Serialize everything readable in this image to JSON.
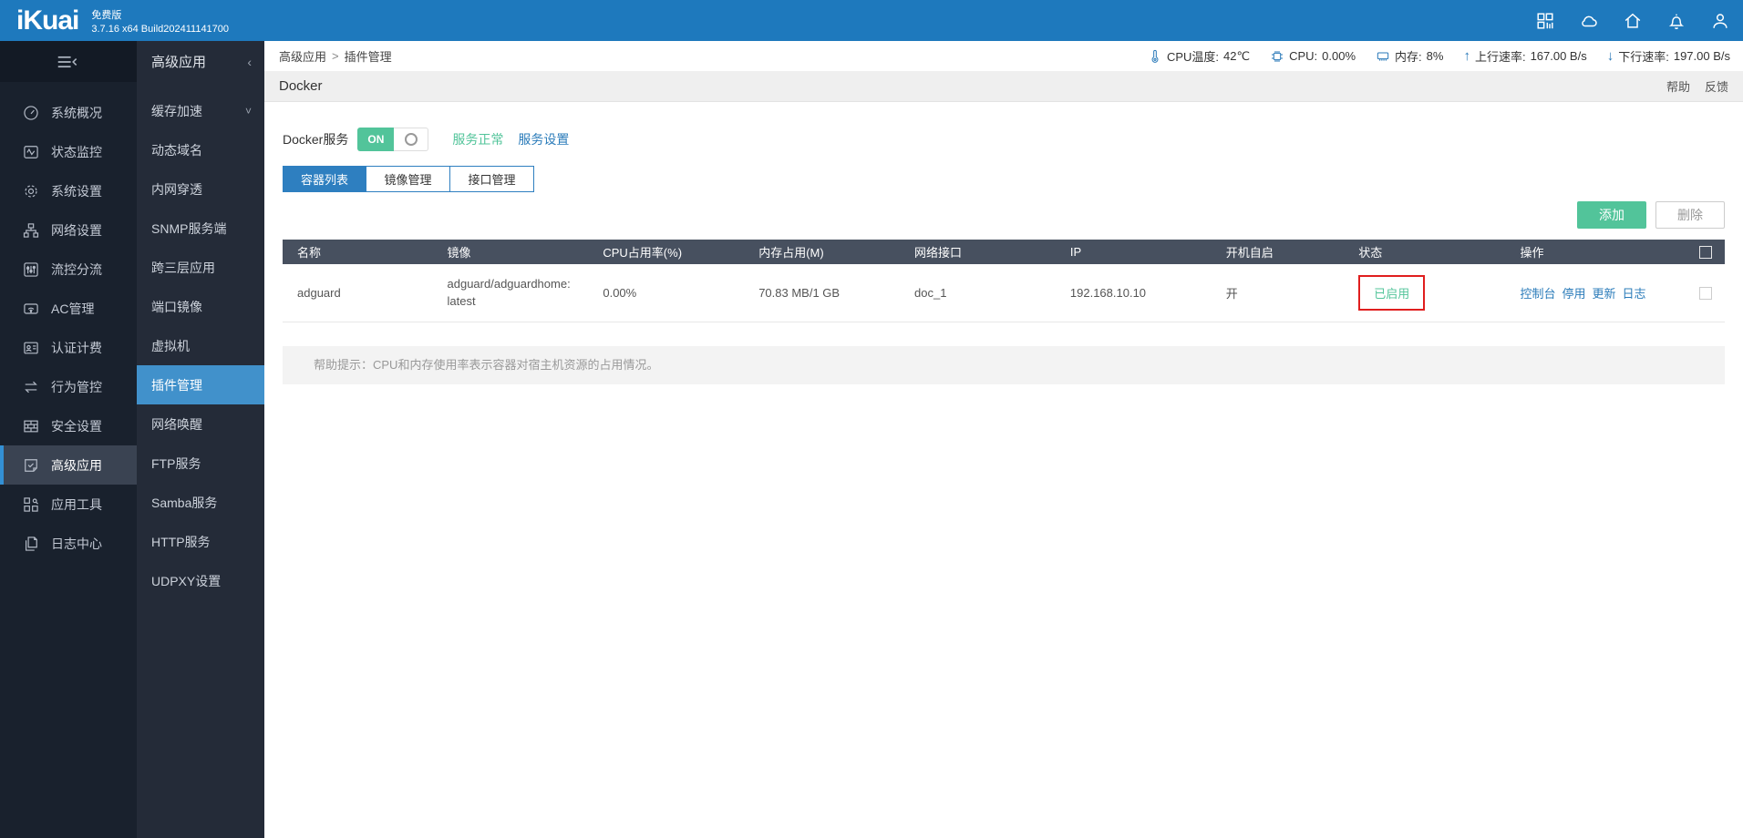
{
  "topbar": {
    "logo": "iKuai",
    "edition": "免费版",
    "build": "3.7.16 x64 Build202411141700"
  },
  "sidebar": {
    "items": [
      {
        "label": "系统概况"
      },
      {
        "label": "状态监控"
      },
      {
        "label": "系统设置"
      },
      {
        "label": "网络设置"
      },
      {
        "label": "流控分流"
      },
      {
        "label": "AC管理"
      },
      {
        "label": "认证计费"
      },
      {
        "label": "行为管控"
      },
      {
        "label": "安全设置"
      },
      {
        "label": "高级应用"
      },
      {
        "label": "应用工具"
      },
      {
        "label": "日志中心"
      }
    ],
    "selected": "高级应用"
  },
  "submenu": {
    "title": "高级应用",
    "collapse_arrow": "‹",
    "items": [
      {
        "label": "缓存加速",
        "chevron": "˅"
      },
      {
        "label": "动态域名"
      },
      {
        "label": "内网穿透"
      },
      {
        "label": "SNMP服务端"
      },
      {
        "label": "跨三层应用"
      },
      {
        "label": "端口镜像"
      },
      {
        "label": "虚拟机"
      },
      {
        "label": "插件管理"
      },
      {
        "label": "网络唤醒"
      },
      {
        "label": "FTP服务"
      },
      {
        "label": "Samba服务"
      },
      {
        "label": "HTTP服务"
      },
      {
        "label": "UDPXY设置"
      }
    ],
    "selected": "插件管理"
  },
  "breadcrumb": {
    "parent": "高级应用",
    "separator": ">",
    "current": "插件管理"
  },
  "statusbar": {
    "cpu_temp": {
      "label": "CPU温度:",
      "value": "42℃"
    },
    "cpu": {
      "label": "CPU:",
      "value": "0.00%"
    },
    "memory": {
      "label": "内存:",
      "value": "8%"
    },
    "upload": {
      "arrow": "↑",
      "label": "上行速率:",
      "value": "167.00 B/s"
    },
    "download": {
      "arrow": "↓",
      "label": "下行速率:",
      "value": "197.00 B/s"
    }
  },
  "page": {
    "title": "Docker",
    "help_link": "帮助",
    "feedback_link": "反馈",
    "service": {
      "label": "Docker服务",
      "toggle_on_label": "ON",
      "status_text": "服务正常",
      "settings_link": "服务设置"
    },
    "tabs": [
      {
        "label": "容器列表",
        "active": true
      },
      {
        "label": "镜像管理",
        "active": false
      },
      {
        "label": "接口管理",
        "active": false
      }
    ],
    "add_button": "添加",
    "delete_button": "删除",
    "table": {
      "headers": [
        "名称",
        "镜像",
        "CPU占用率(%)",
        "内存占用(M)",
        "网络接口",
        "IP",
        "开机自启",
        "状态",
        "操作"
      ],
      "rows": [
        {
          "name": "adguard",
          "image": "adguard/adguardhome:latest",
          "cpu": "0.00%",
          "memory": "70.83 MB/1 GB",
          "interface": "doc_1",
          "ip": "192.168.10.10",
          "autostart": "开",
          "status": "已启用",
          "actions": {
            "console": "控制台",
            "stop": "停用",
            "update": "更新",
            "log": "日志"
          }
        }
      ]
    },
    "help_tip": "帮助提示：CPU和内存使用率表示容器对宿主机资源的占用情况。"
  },
  "colors": {
    "brand_blue": "#1e79bd",
    "accent_green": "#52c49a",
    "link_blue": "#2b7cba",
    "tab_blue": "#2e7fc0",
    "table_header": "#47505f",
    "annotation_red": "#e01e1e"
  }
}
